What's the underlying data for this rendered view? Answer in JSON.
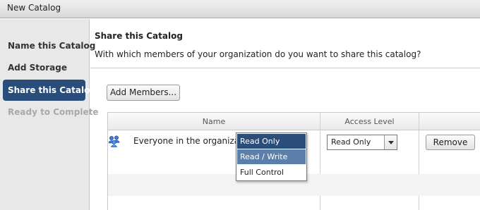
{
  "window": {
    "title": "New Catalog"
  },
  "sidebar": {
    "steps": [
      {
        "label": "Name this Catalog",
        "state": "done"
      },
      {
        "label": "Add Storage",
        "state": "done"
      },
      {
        "label": "Share this Catalog",
        "state": "active"
      },
      {
        "label": "Ready to Complete",
        "state": "disabled"
      }
    ]
  },
  "main": {
    "heading": "Share this Catalog",
    "question": "With which members of your organization do you want to share this catalog?",
    "add_members_label": "Add Members...",
    "table": {
      "columns": [
        "Name",
        "Access Level"
      ],
      "rows": [
        {
          "icon": "group-icon",
          "name": "Everyone in the organization",
          "access_level": "Read Only",
          "remove_label": "Remove"
        }
      ]
    },
    "access_dropdown": {
      "options": [
        "Read Only",
        "Read / Write",
        "Full Control"
      ],
      "selected": "Read Only",
      "hovered": "Read / Write"
    }
  },
  "colors": {
    "accent": "#2b4d7a",
    "hover": "#5b7fa8",
    "disabled_text": "#a8a8a8"
  }
}
